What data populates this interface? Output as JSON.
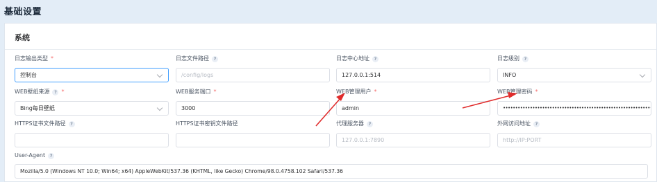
{
  "page": {
    "title": "基础设置"
  },
  "section": {
    "title": "系统"
  },
  "row1": {
    "log_output_type": {
      "label": "日志输出类型",
      "value": "控制台"
    },
    "log_file_path": {
      "label": "日志文件路径",
      "placeholder": "/config/logs"
    },
    "log_center_address": {
      "label": "日志中心地址",
      "value": "127.0.0.1:514"
    },
    "log_level": {
      "label": "日志级别",
      "value": "INFO"
    }
  },
  "row2": {
    "web_wallpaper_source": {
      "label": "WEB壁纸来源",
      "value": "Bing每日壁纸"
    },
    "web_service_port": {
      "label": "WEB服务端口",
      "value": "3000"
    },
    "web_admin_user": {
      "label": "WEB管理用户",
      "value": "admin"
    },
    "web_admin_password": {
      "label": "WEB管理密码",
      "value": "••••••••••••••••••••••••••••••••••••••••••••••••••••••••••••••••••••••••••••••••••••••••••••••••••••••••••••"
    }
  },
  "row3": {
    "https_cert_path": {
      "label": "HTTPS证书文件路径",
      "value": ""
    },
    "https_key_path": {
      "label": "HTTPS证书密钥文件路径",
      "value": ""
    },
    "proxy_server": {
      "label": "代理服务器",
      "placeholder": "127.0.0.1:7890"
    },
    "external_address": {
      "label": "外网访问地址",
      "placeholder": "http://IP:PORT"
    }
  },
  "user_agent": {
    "label": "User-Agent",
    "value": "Mozilla/5.0 (Windows NT 10.0; Win64; x64) AppleWebKit/537.36 (KHTML, like Gecko) Chrome/98.0.4758.102 Safari/537.36"
  },
  "glyphs": {
    "help": "?",
    "required": "*"
  },
  "colors": {
    "page_bg": "#e3edf7",
    "focus_border": "#409eff",
    "required": "#f56c6c",
    "annotation_arrow": "#e02c2c"
  }
}
